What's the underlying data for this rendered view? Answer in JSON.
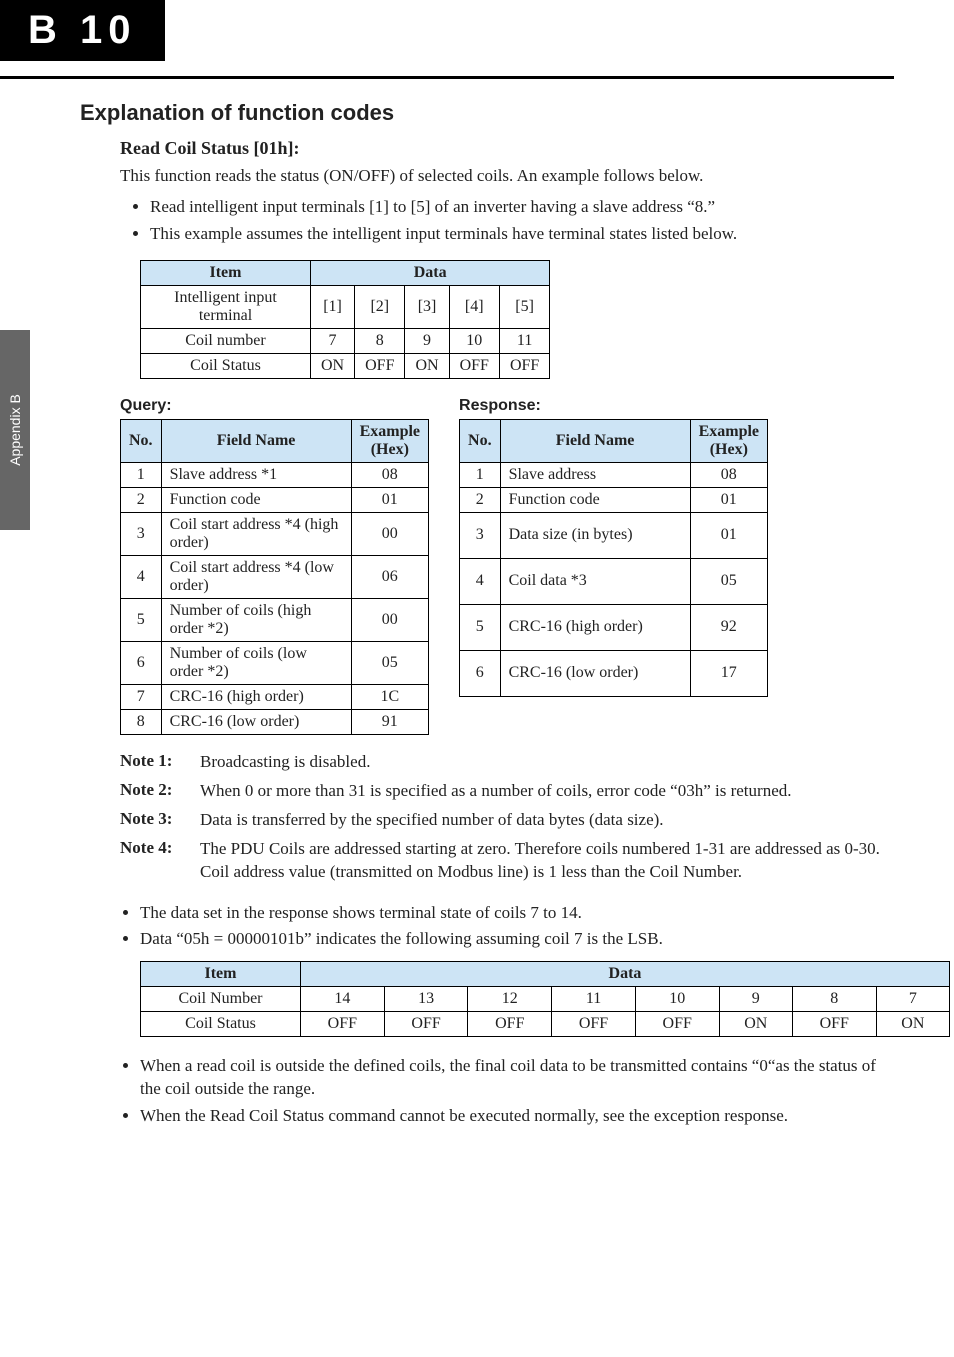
{
  "header": {
    "tab_letter": "B",
    "tab_number": "10",
    "side_tab": "Appendix B"
  },
  "section_title": "Explanation of function codes",
  "subsection_title": "Read Coil Status [01h]:",
  "intro_para": "This function reads the status (ON/OFF) of selected coils. An example follows below.",
  "intro_bullets": [
    "Read intelligent input terminals [1] to [5] of an inverter having a slave address “8.”",
    "This example assumes the intelligent input terminals have terminal states listed below."
  ],
  "table1": {
    "header_item": "Item",
    "header_data": "Data",
    "rows": [
      {
        "label": "Intelligent input terminal",
        "cells": [
          "[1]",
          "[2]",
          "[3]",
          "[4]",
          "[5]"
        ]
      },
      {
        "label": "Coil number",
        "cells": [
          "7",
          "8",
          "9",
          "10",
          "11"
        ]
      },
      {
        "label": "Coil Status",
        "cells": [
          "ON",
          "OFF",
          "ON",
          "OFF",
          "OFF"
        ]
      }
    ]
  },
  "query_title": "Query:",
  "response_title": "Response:",
  "query_table": {
    "h_no": "No.",
    "h_name": "Field Name",
    "h_ex": "Example (Hex)",
    "rows": [
      {
        "no": "1",
        "name": "Slave address *1",
        "ex": "08"
      },
      {
        "no": "2",
        "name": "Function code",
        "ex": "01"
      },
      {
        "no": "3",
        "name": "Coil start address *4 (high order)",
        "ex": "00"
      },
      {
        "no": "4",
        "name": "Coil start address *4 (low order)",
        "ex": "06"
      },
      {
        "no": "5",
        "name": "Number of coils (high order *2)",
        "ex": "00"
      },
      {
        "no": "6",
        "name": "Number of coils (low order *2)",
        "ex": "05"
      },
      {
        "no": "7",
        "name": "CRC-16 (high order)",
        "ex": "1C"
      },
      {
        "no": "8",
        "name": "CRC-16 (low order)",
        "ex": "91"
      }
    ]
  },
  "response_table": {
    "h_no": "No.",
    "h_name": "Field Name",
    "h_ex": "Example (Hex)",
    "rows": [
      {
        "no": "1",
        "name": "Slave address",
        "ex": "08"
      },
      {
        "no": "2",
        "name": "Function code",
        "ex": "01"
      },
      {
        "no": "3",
        "name": "Data size (in bytes)",
        "ex": "01"
      },
      {
        "no": "4",
        "name": "Coil data *3",
        "ex": "05"
      },
      {
        "no": "5",
        "name": "CRC-16 (high order)",
        "ex": "92"
      },
      {
        "no": "6",
        "name": "CRC-16 (low order)",
        "ex": "17"
      }
    ]
  },
  "notes": [
    {
      "label": "Note 1:",
      "text": "Broadcasting is disabled."
    },
    {
      "label": "Note 2:",
      "text": "When 0 or more than 31 is specified as a number of coils, error code “03h” is returned."
    },
    {
      "label": "Note 3:",
      "text": "Data is transferred by the specified number of data bytes (data size)."
    },
    {
      "label": "Note 4:",
      "text": "The PDU Coils are addressed starting at zero. Therefore coils numbered 1-31 are addressed as 0-30. Coil address value (transmitted on Modbus line) is 1 less than the Coil Number."
    }
  ],
  "bullets2": [
    "The data set in the response shows terminal state of coils 7 to 14.",
    "Data “05h = 00000101b” indicates the following assuming coil 7 is the LSB."
  ],
  "table3": {
    "header_item": "Item",
    "header_data": "Data",
    "rows": [
      {
        "label": "Coil Number",
        "cells": [
          "14",
          "13",
          "12",
          "11",
          "10",
          "9",
          "8",
          "7"
        ]
      },
      {
        "label": "Coil Status",
        "cells": [
          "OFF",
          "OFF",
          "OFF",
          "OFF",
          "OFF",
          "ON",
          "OFF",
          "ON"
        ]
      }
    ]
  },
  "bullets3": [
    "When a read coil is outside the defined coils, the final coil data to be transmitted contains “0“as the status of the coil outside the range.",
    "When the Read Coil Status command cannot be executed normally, see the exception response."
  ]
}
